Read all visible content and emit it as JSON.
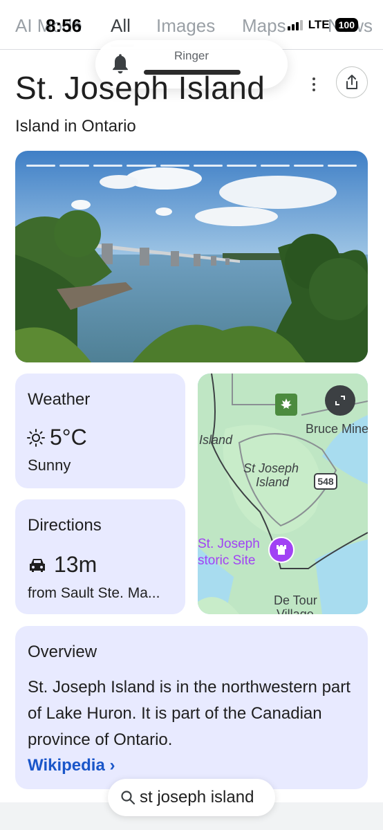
{
  "status": {
    "time": "8:56",
    "network": "LTE",
    "battery": "100"
  },
  "tabs": [
    {
      "label": "AI Mode"
    },
    {
      "label": "All"
    },
    {
      "label": "Images"
    },
    {
      "label": "Maps"
    },
    {
      "label": "News"
    }
  ],
  "ringer": {
    "label": "Ringer"
  },
  "entity": {
    "title": "St. Joseph Island",
    "subtitle": "Island in Ontario"
  },
  "weather": {
    "title": "Weather",
    "temp": "5°C",
    "condition": "Sunny",
    "icon": "sun-icon"
  },
  "directions": {
    "title": "Directions",
    "time": "13m",
    "from": "from Sault Ste. Ma...",
    "icon": "car-icon"
  },
  "map": {
    "labels": {
      "bruce_mines": "Bruce Mine",
      "island": "Island",
      "st_joseph_1": "St Joseph",
      "st_joseph_2": "Island",
      "route": "548",
      "poi_1": "St. Joseph",
      "poi_2": "storic Site",
      "de_tour": "De Tour",
      "village": "Village"
    }
  },
  "overview": {
    "title": "Overview",
    "text": "St. Joseph Island is in the northwestern part of Lake Huron. It is part of the Canadian province of Ontario.",
    "link": "Wikipedia",
    "link_chevron": "›"
  },
  "search": {
    "query": "st joseph island"
  },
  "colors": {
    "card_bg": "#e8eaff",
    "link": "#1a56c9",
    "water": "#a8dcef",
    "land": "#bfe6c4",
    "poi": "#a142f4"
  }
}
